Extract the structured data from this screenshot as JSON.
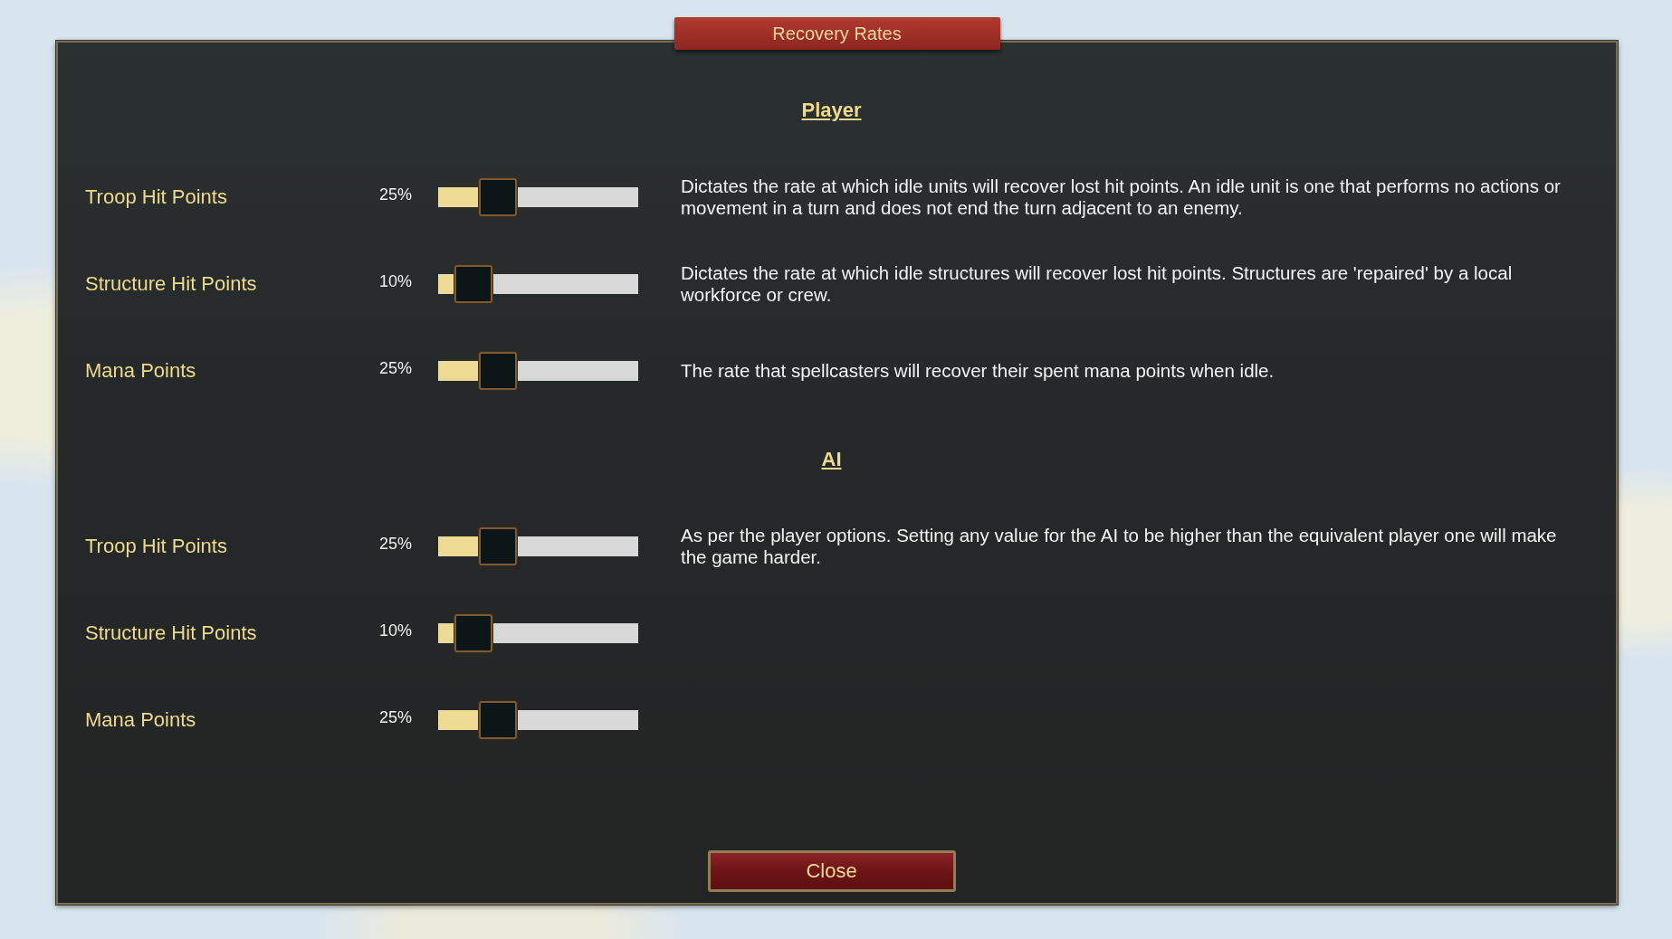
{
  "window": {
    "title": "Recovery Rates"
  },
  "sections": [
    {
      "title": "Player",
      "rows": [
        {
          "label": "Troop Hit Points",
          "reading": "25%",
          "level": 0.25,
          "description": "Dictates the rate at which idle units will recover lost hit points. An idle unit is one that performs no actions or movement in a turn and does not end the turn adjacent to an enemy."
        },
        {
          "label": "Structure Hit Points",
          "reading": "10%",
          "level": 0.1,
          "description": "Dictates the rate at which idle structures will recover lost hit points. Structures are 'repaired' by a local workforce or crew."
        },
        {
          "label": "Mana Points",
          "reading": "25%",
          "level": 0.25,
          "description": "The rate that spellcasters will recover their spent mana points when idle."
        }
      ]
    },
    {
      "title": "AI",
      "rows": [
        {
          "label": "Troop Hit Points",
          "reading": "25%",
          "level": 0.25,
          "description": "As per the player options. Setting any value for the AI to be higher than the equivalent player one will make the game harder."
        },
        {
          "label": "Structure Hit Points",
          "reading": "10%",
          "level": 0.1
        },
        {
          "label": "Mana Points",
          "reading": "25%",
          "level": 0.25
        }
      ]
    }
  ],
  "buttons": [
    "Close"
  ]
}
